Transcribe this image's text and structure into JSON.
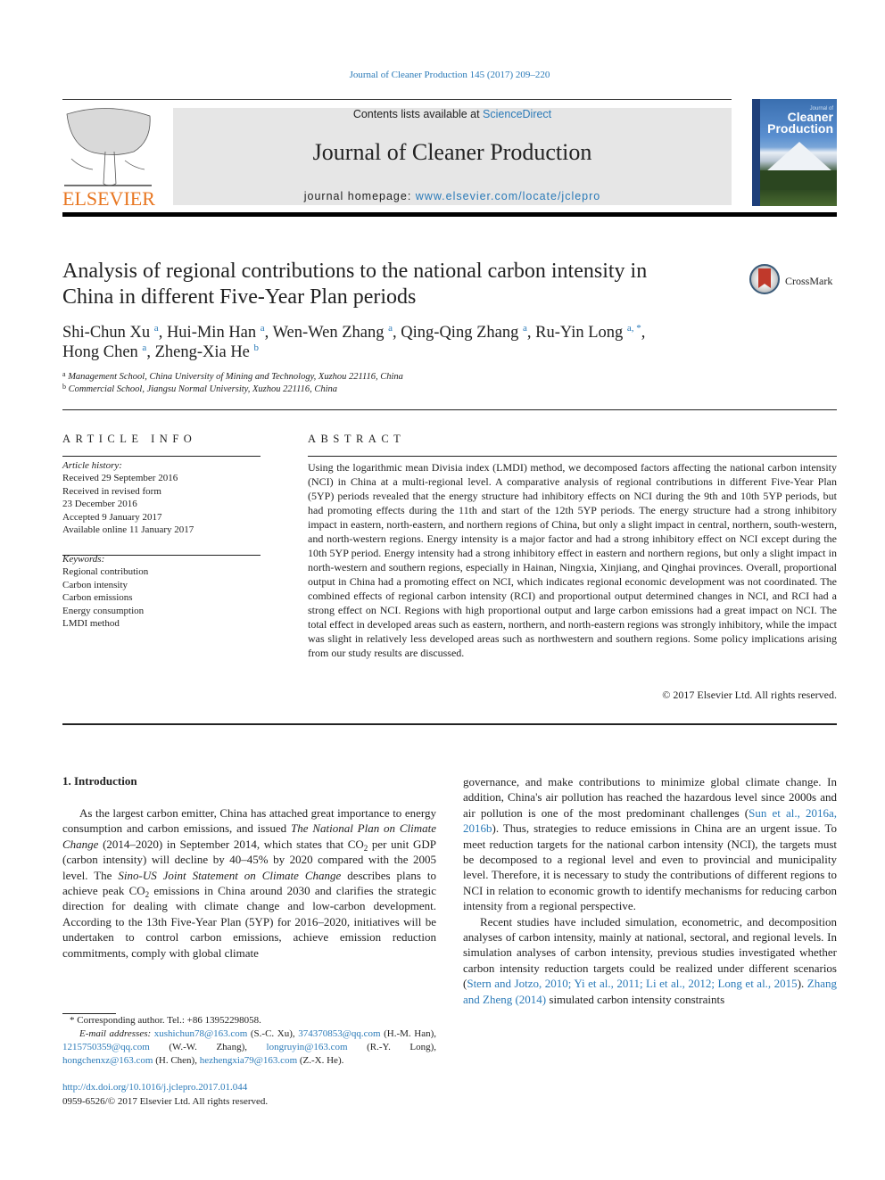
{
  "journal_ref": "Journal of Cleaner Production 145 (2017) 209–220",
  "masthead": {
    "publisher": "ELSEVIER",
    "contents_prefix": "Contents lists available at ",
    "contents_link": "ScienceDirect",
    "journal_title": "Journal of Cleaner Production",
    "homepage_prefix": "journal homepage: ",
    "homepage_link": "www.elsevier.com/locate/jclepro",
    "cover": {
      "line1": "Journal of",
      "line2": "Cleaner",
      "line3": "Production"
    },
    "colors": {
      "publisher_orange": "#e87722",
      "link_blue": "#2a7ab8",
      "box_gray": "#e6e6e6"
    }
  },
  "article": {
    "title_line1": "Analysis of regional contributions to the national carbon intensity in",
    "title_line2": "China in different Five-Year Plan periods",
    "crossmark_label": "CrossMark",
    "authors": [
      {
        "name": "Shi-Chun Xu",
        "sup": "a",
        "sep": ", "
      },
      {
        "name": "Hui-Min Han",
        "sup": "a",
        "sep": ", "
      },
      {
        "name": "Wen-Wen Zhang",
        "sup": "a",
        "sep": ", "
      },
      {
        "name": "Qing-Qing Zhang",
        "sup": "a",
        "sep": ", "
      },
      {
        "name": "Ru-Yin Long",
        "sup": "a, *",
        "sep": ","
      },
      {
        "name": "Hong Chen",
        "sup": "a",
        "sep": ", "
      },
      {
        "name": "Zheng-Xia He",
        "sup": "b",
        "sep": ""
      }
    ],
    "affiliations": [
      {
        "sup": "a",
        "text": "Management School, China University of Mining and Technology, Xuzhou 221116, China"
      },
      {
        "sup": "b",
        "text": "Commercial School, Jiangsu Normal University, Xuzhou 221116, China"
      }
    ]
  },
  "article_info": {
    "heading": "ARTICLE INFO",
    "history_label": "Article history:",
    "history": [
      "Received 29 September 2016",
      "Received in revised form",
      "23 December 2016",
      "Accepted 9 January 2017",
      "Available online 11 January 2017"
    ],
    "keywords_label": "Keywords:",
    "keywords": [
      "Regional contribution",
      "Carbon intensity",
      "Carbon emissions",
      "Energy consumption",
      "LMDI method"
    ]
  },
  "abstract": {
    "heading": "ABSTRACT",
    "text": "Using the logarithmic mean Divisia index (LMDI) method, we decomposed factors affecting the national carbon intensity (NCI) in China at a multi-regional level. A comparative analysis of regional contributions in different Five-Year Plan (5YP) periods revealed that the energy structure had inhibitory effects on NCI during the 9th and 10th 5YP periods, but had promoting effects during the 11th and start of the 12th 5YP periods. The energy structure had a strong inhibitory impact in eastern, north-eastern, and northern regions of China, but only a slight impact in central, northern, south-western, and north-western regions. Energy intensity is a major factor and had a strong inhibitory effect on NCI except during the 10th 5YP period. Energy intensity had a strong inhibitory effect in eastern and northern regions, but only a slight impact in north-western and southern regions, especially in Hainan, Ningxia, Xinjiang, and Qinghai provinces. Overall, proportional output in China had a promoting effect on NCI, which indicates regional economic development was not coordinated. The combined effects of regional carbon intensity (RCI) and proportional output determined changes in NCI, and RCI had a strong effect on NCI. Regions with high proportional output and large carbon emissions had a great impact on NCI. The total effect in developed areas such as eastern, northern, and north-eastern regions was strongly inhibitory, while the impact was slight in relatively less developed areas such as northwestern and southern regions. Some policy implications arising from our study results are discussed.",
    "copyright": "© 2017 Elsevier Ltd. All rights reserved."
  },
  "body": {
    "section_heading": "1.  Introduction",
    "left_col": {
      "p1_a": "As the largest carbon emitter, China has attached great importance to energy consumption and carbon emissions, and issued ",
      "p1_i1": "The National Plan on Climate Change",
      "p1_b": " (2014–2020) in September 2014, which states that CO",
      "p1_sub1": "2",
      "p1_c": " per unit GDP (carbon intensity) will decline by 40–45% by 2020 compared with the 2005 level. The ",
      "p1_i2": "Sino-US Joint Statement on Climate Change",
      "p1_d": " describes plans to achieve peak CO",
      "p1_sub2": "2",
      "p1_e": " emissions in China around 2030 and clarifies the strategic direction for dealing with climate change and low-carbon development. According to the 13th Five-Year Plan (5YP) for 2016–2020, initiatives will be undertaken to control carbon emissions, achieve emission reduction commitments, comply with global climate"
    },
    "right_col": {
      "p1_a": "governance, and make contributions to minimize global climate change. In addition, China's air pollution has reached the hazardous level since 2000s and air pollution is one of the most predominant challenges (",
      "p1_link": "Sun et al., 2016a, 2016b",
      "p1_b": "). Thus, strategies to reduce emissions in China are an urgent issue. To meet reduction targets for the national carbon intensity (NCI), the targets must be decomposed to a regional level and even to provincial and municipality level. Therefore, it is necessary to study the contributions of different regions to NCI in relation to economic growth to identify mechanisms for reducing carbon intensity from a regional perspective.",
      "p2_a": "Recent studies have included simulation, econometric, and decomposition analyses of carbon intensity, mainly at national, sectoral, and regional levels. In simulation analyses of carbon intensity, previous studies investigated whether carbon intensity reduction targets could be realized under different scenarios (",
      "p2_link1": "Stern and Jotzo, 2010; Yi et al., 2011; Li et al., 2012; Long et al., 2015",
      "p2_b": "). ",
      "p2_link2": "Zhang and Zheng (2014)",
      "p2_c": " simulated carbon intensity constraints"
    }
  },
  "footnote": {
    "corresponding": "* Corresponding author. Tel.: +86 13952298058.",
    "email_label": "E-mail addresses:",
    "emails": [
      {
        "email": "xushichun78@163.com",
        "who": " (S.-C. Xu), "
      },
      {
        "email": "374370853@qq.com",
        "who": " (H.-M. Han), "
      },
      {
        "email": "1215750359@qq.com",
        "who": " (W.-W. Zhang), "
      },
      {
        "email": "longruyin@163.com",
        "who": " (R.-Y. Long), "
      },
      {
        "email": "hongchenxz@163.com",
        "who": " (H. Chen), "
      },
      {
        "email": "hezhengxia79@163.com",
        "who": " (Z.-X. He)."
      }
    ],
    "doi": "http://dx.doi.org/10.1016/j.jclepro.2017.01.044",
    "issn_line": "0959-6526/© 2017 Elsevier Ltd. All rights reserved."
  }
}
